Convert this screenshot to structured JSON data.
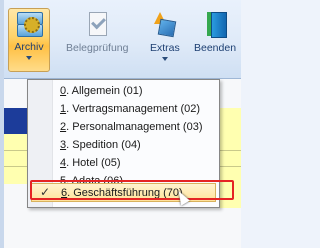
{
  "ribbon": {
    "buttons": [
      {
        "id": "archiv",
        "label": "Archiv",
        "icon": "archive-cabinet-icon",
        "active": true,
        "dropdown": true
      },
      {
        "id": "belegpruefung",
        "label": "Belegprüfung",
        "icon": "document-check-icon",
        "active": false,
        "dropdown": false
      },
      {
        "id": "extras",
        "label": "Extras",
        "icon": "tools-icon",
        "active": false,
        "dropdown": true
      },
      {
        "id": "beenden",
        "label": "Beenden",
        "icon": "exit-door-icon",
        "active": false,
        "dropdown": false
      }
    ]
  },
  "archiv_menu": {
    "items": [
      {
        "key": "0",
        "rest": ". Allgemein (01)",
        "checked": false
      },
      {
        "key": "1",
        "rest": ". Vertragsmanagement (02)",
        "checked": false
      },
      {
        "key": "2",
        "rest": ". Personalmanagement (03)",
        "checked": false
      },
      {
        "key": "3",
        "rest": ". Spedition (04)",
        "checked": false
      },
      {
        "key": "4",
        "rest": ". Hotel (05)",
        "checked": false
      },
      {
        "key": "5",
        "rest": ". Adata (06)",
        "checked": false
      },
      {
        "key": "6",
        "rest": ". Geschäftsführung (70)",
        "checked": true
      }
    ]
  },
  "colors": {
    "highlight_border": "#e52424",
    "selected_bg": "#ffe39a",
    "ribbon_bg": "#dfeaf8"
  }
}
